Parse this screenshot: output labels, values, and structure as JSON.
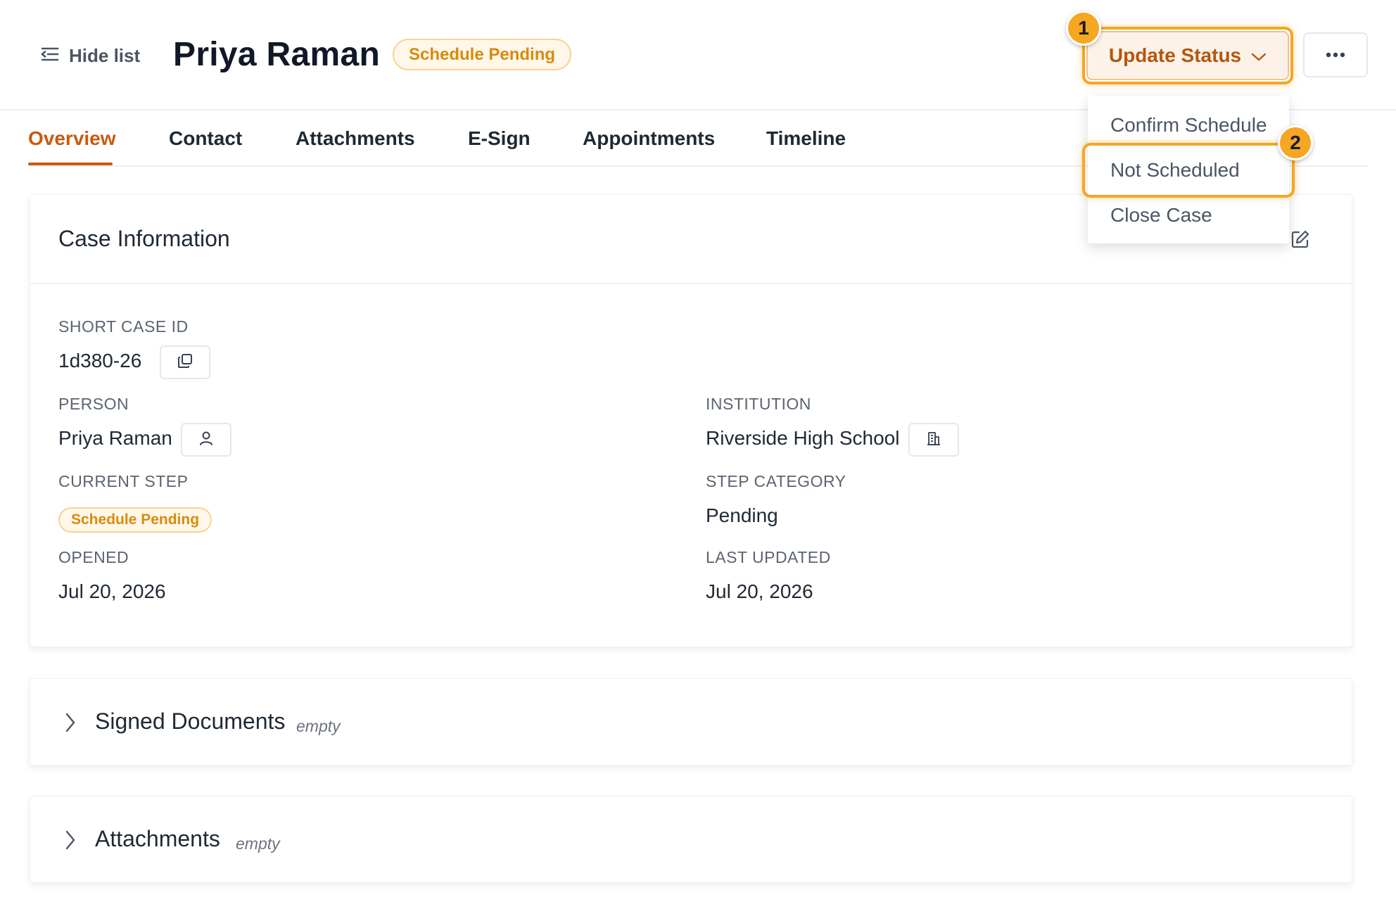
{
  "header": {
    "hide_list_label": "Hide list",
    "title": "Priya Raman",
    "status_badge": "Schedule Pending",
    "update_status_label": "Update Status"
  },
  "tabs": [
    {
      "label": "Overview",
      "active": true
    },
    {
      "label": "Contact",
      "active": false
    },
    {
      "label": "Attachments",
      "active": false
    },
    {
      "label": "E-Sign",
      "active": false
    },
    {
      "label": "Appointments",
      "active": false
    },
    {
      "label": "Timeline",
      "active": false
    }
  ],
  "case_info": {
    "title": "Case Information",
    "short_case_id_label": "SHORT CASE ID",
    "short_case_id": "1d380-26",
    "person_label": "PERSON",
    "person": "Priya Raman",
    "institution_label": "INSTITUTION",
    "institution": "Riverside High School",
    "current_step_label": "CURRENT STEP",
    "current_step": "Schedule Pending",
    "step_category_label": "STEP CATEGORY",
    "step_category": "Pending",
    "opened_label": "OPENED",
    "opened": "Jul 20, 2026",
    "last_updated_label": "LAST UPDATED",
    "last_updated": "Jul 20, 2026"
  },
  "sections": {
    "signed_documents": {
      "title": "Signed Documents",
      "empty_label": "empty"
    },
    "attachments": {
      "title": "Attachments",
      "empty_label": "empty"
    }
  },
  "dropdown": {
    "items": [
      {
        "label": "Confirm Schedule"
      },
      {
        "label": "Not Scheduled"
      },
      {
        "label": "Close Case"
      }
    ]
  },
  "markers": [
    "1",
    "2"
  ],
  "colors": {
    "accent": "#c75a10",
    "badge_text": "#d98a0c",
    "badge_bg": "#fff8ea",
    "highlight": "#f5a623"
  }
}
